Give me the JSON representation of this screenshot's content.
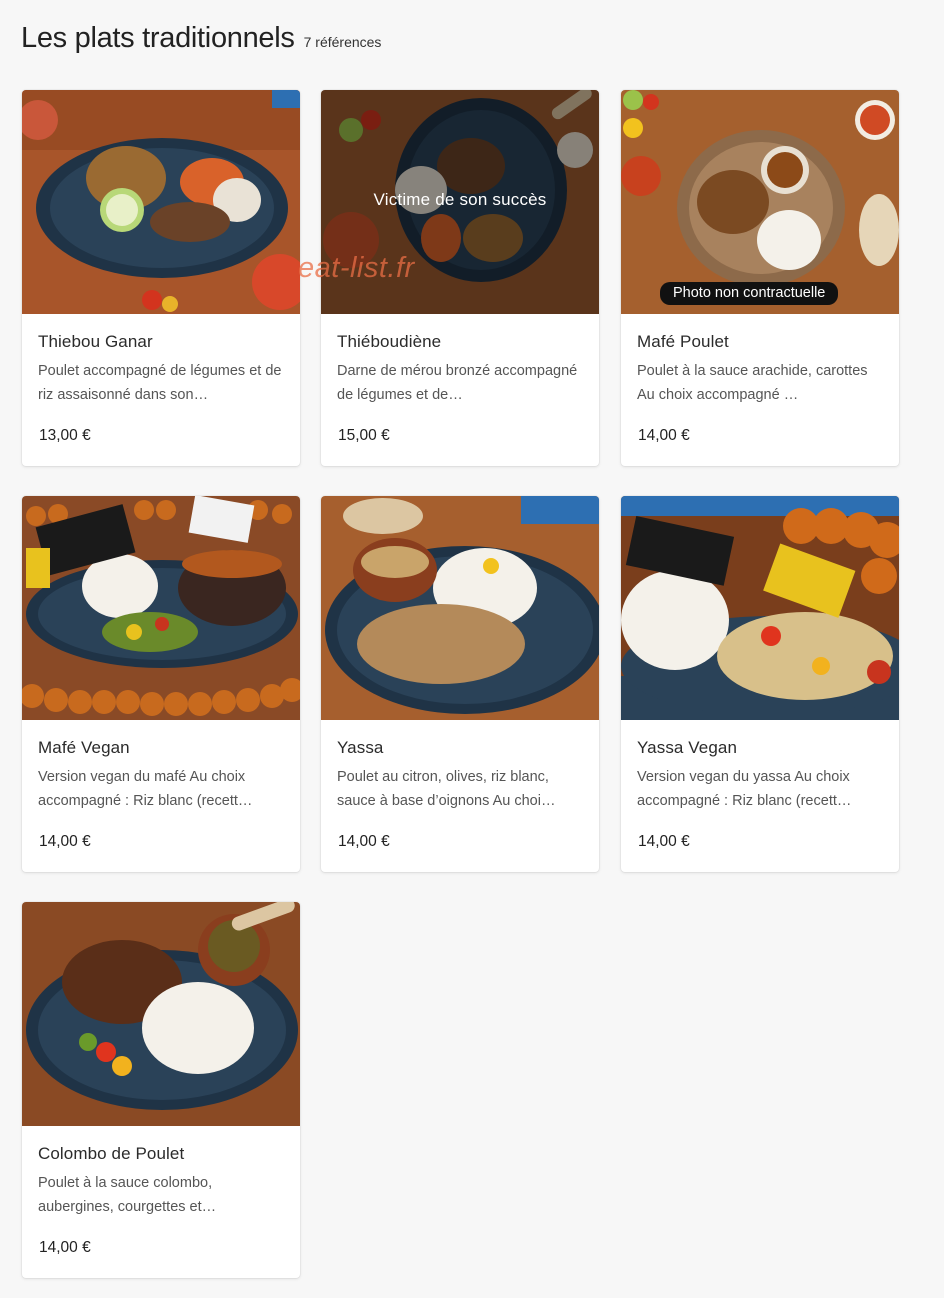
{
  "section": {
    "title": "Les plats traditionnels",
    "count": "7 références"
  },
  "colors": {
    "page_bg": "#f7f7f7",
    "card_bg": "#ffffff",
    "price_text": "#222222",
    "badge_bg": "#111111",
    "watermark": "#ea6e46"
  },
  "watermark": "eat-list.fr",
  "dishes": [
    {
      "name": "Thiebou Ganar",
      "description": "Poulet accompagné de légumes et de riz assaisonné dans son…",
      "price": "13,00 €"
    },
    {
      "name": "Thiéboudiène",
      "description": "Darne de mérou bronzé accompagné de légumes et de…",
      "price": "15,00 €",
      "overlay": "Victime de son succès"
    },
    {
      "name": "Mafé Poulet",
      "description": "Poulet à la sauce arachide, carottes Au choix accompagné …",
      "price": "14,00 €",
      "badge": "Photo non contractuelle"
    },
    {
      "name": "Mafé Vegan",
      "description": "Version vegan du mafé Au choix accompagné : Riz blanc (recett…",
      "price": "14,00 €"
    },
    {
      "name": "Yassa",
      "description": "Poulet au citron, olives, riz blanc, sauce à base d’oignons Au choi…",
      "price": "14,00 €"
    },
    {
      "name": "Yassa Vegan",
      "description": "Version vegan du yassa Au choix accompagné : Riz blanc (recett…",
      "price": "14,00 €"
    },
    {
      "name": "Colombo de Poulet",
      "description": "Poulet à la sauce colombo, aubergines, courgettes et…",
      "price": "14,00 €"
    }
  ]
}
